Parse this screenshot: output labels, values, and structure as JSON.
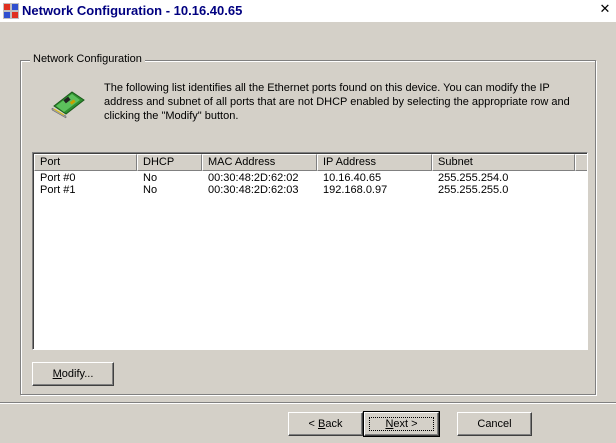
{
  "window": {
    "title": "Network Configuration - 10.16.40.65",
    "close_glyph": "✕"
  },
  "group": {
    "legend": "Network Configuration"
  },
  "description": "The following list identifies all the Ethernet ports found on this device. You can modify the IP address and subnet of all ports that are not DHCP enabled by selecting the appropriate row and clicking the \"Modify\" button.",
  "table": {
    "columns": [
      "Port",
      "DHCP",
      "MAC Address",
      "IP Address",
      "Subnet"
    ],
    "rows": [
      [
        "Port #0",
        "No",
        "00:30:48:2D:62:02",
        "10.16.40.65",
        "255.255.254.0"
      ],
      [
        "Port #1",
        "No",
        "00:30:48:2D:62:03",
        "192.168.0.97",
        "255.255.255.0"
      ]
    ]
  },
  "buttons": {
    "modify": {
      "mnemonic": "M",
      "rest": "odify..."
    },
    "back": {
      "prefix": "< ",
      "mnemonic": "B",
      "rest": "ack"
    },
    "next": {
      "mnemonic": "N",
      "rest": "ext >"
    },
    "cancel": "Cancel"
  },
  "icons": {
    "title": "network-config-icon",
    "info": "network-card-icon"
  }
}
